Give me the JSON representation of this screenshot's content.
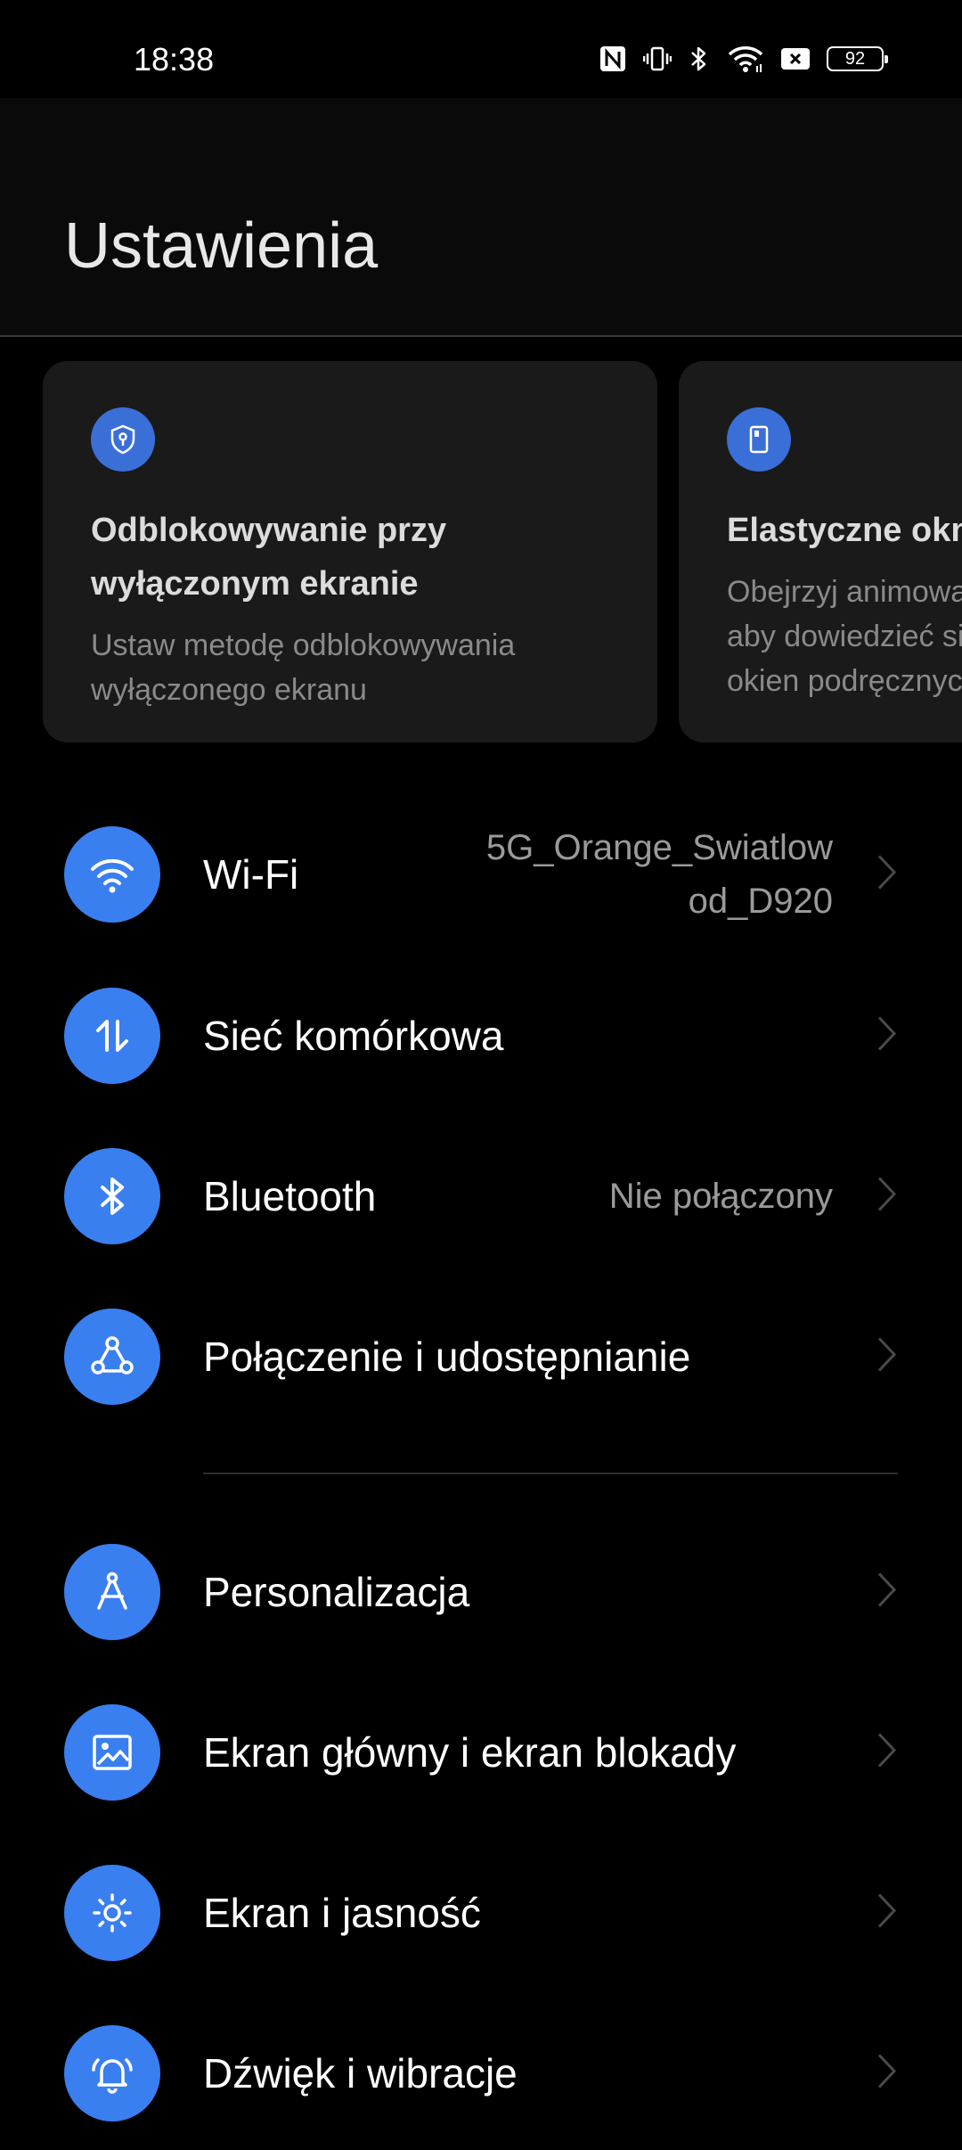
{
  "status_bar": {
    "time": "18:38",
    "battery": "92",
    "icons": [
      "nfc-icon",
      "vibrate-icon",
      "bluetooth-icon",
      "wifi-icon",
      "no-sim-icon",
      "battery-icon"
    ]
  },
  "header": {
    "title": "Ustawienia"
  },
  "cards": [
    {
      "icon": "shield-key-icon",
      "title": "Odblokowywanie przy\nwyłączonym ekranie",
      "description": "Ustaw metodę odblokowywania\nwyłączonego ekranu"
    },
    {
      "icon": "floating-window-icon",
      "title": "Elastyczne okna",
      "description": "Obejrzyj animowany przewodnik,\naby dowiedzieć się więcej o funkcji\nokien podręcznych"
    }
  ],
  "settings": [
    {
      "icon": "wifi-icon",
      "label": "Wi-Fi",
      "value": "5G_Orange_Swiatlow\nod_D920"
    },
    {
      "icon": "mobile-data-icon",
      "label": "Sieć komórkowa",
      "value": ""
    },
    {
      "icon": "bluetooth-icon",
      "label": "Bluetooth",
      "value": "Nie połączony"
    },
    {
      "icon": "connection-sharing-icon",
      "label": "Połączenie i udostępnianie",
      "value": ""
    },
    {
      "icon": "personalization-icon",
      "label": "Personalizacja",
      "value": ""
    },
    {
      "icon": "wallpaper-icon",
      "label": "Ekran główny i ekran blokady",
      "value": ""
    },
    {
      "icon": "brightness-icon",
      "label": "Ekran i jasność",
      "value": ""
    },
    {
      "icon": "sound-icon",
      "label": "Dźwięk i wibracje",
      "value": ""
    }
  ],
  "colors": {
    "accent": "#3a7ff0",
    "card_bg": "#1a1a1a",
    "background": "#000000"
  }
}
